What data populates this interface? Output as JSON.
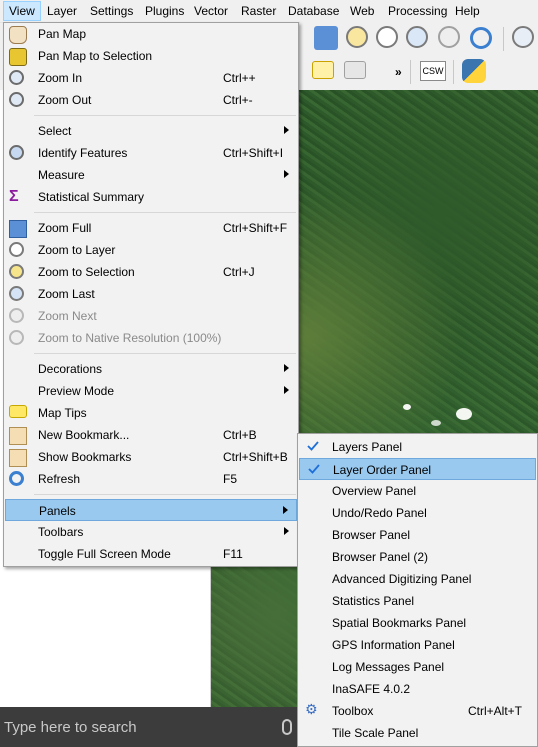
{
  "menubar": {
    "items": [
      "View",
      "Layer",
      "Settings",
      "Plugins",
      "Vector",
      "Raster",
      "Database",
      "Web",
      "Processing",
      "Help"
    ]
  },
  "view_menu": {
    "items": [
      {
        "label": "Pan Map",
        "shortcut": "",
        "icon": "pan-hand-icon"
      },
      {
        "label": "Pan Map to Selection",
        "shortcut": "",
        "icon": "pan-selection-icon"
      },
      {
        "label": "Zoom In",
        "shortcut": "Ctrl++",
        "icon": "zoom-in-icon"
      },
      {
        "label": "Zoom Out",
        "shortcut": "Ctrl+-",
        "icon": "zoom-out-icon"
      },
      {
        "label": "Select",
        "shortcut": "",
        "icon": "",
        "submenu": true
      },
      {
        "label": "Identify Features",
        "shortcut": "Ctrl+Shift+I",
        "icon": "identify-icon"
      },
      {
        "label": "Measure",
        "shortcut": "",
        "icon": "",
        "submenu": true
      },
      {
        "label": "Statistical Summary",
        "shortcut": "",
        "icon": "sigma-icon"
      },
      {
        "label": "Zoom Full",
        "shortcut": "Ctrl+Shift+F",
        "icon": "zoom-full-icon"
      },
      {
        "label": "Zoom to Layer",
        "shortcut": "",
        "icon": "zoom-layer-icon"
      },
      {
        "label": "Zoom to Selection",
        "shortcut": "Ctrl+J",
        "icon": "zoom-selection-icon"
      },
      {
        "label": "Zoom Last",
        "shortcut": "",
        "icon": "zoom-last-icon"
      },
      {
        "label": "Zoom Next",
        "shortcut": "",
        "icon": "zoom-next-icon",
        "disabled": true
      },
      {
        "label": "Zoom to Native Resolution (100%)",
        "shortcut": "",
        "icon": "zoom-native-icon",
        "disabled": true
      },
      {
        "label": "Decorations",
        "shortcut": "",
        "icon": "",
        "submenu": true
      },
      {
        "label": "Preview Mode",
        "shortcut": "",
        "icon": "",
        "submenu": true
      },
      {
        "label": "Map Tips",
        "shortcut": "",
        "icon": "map-tips-icon"
      },
      {
        "label": "New Bookmark...",
        "shortcut": "Ctrl+B",
        "icon": "new-bookmark-icon"
      },
      {
        "label": "Show Bookmarks",
        "shortcut": "Ctrl+Shift+B",
        "icon": "show-bookmarks-icon"
      },
      {
        "label": "Refresh",
        "shortcut": "F5",
        "icon": "refresh-icon"
      },
      {
        "label": "Panels",
        "shortcut": "",
        "icon": "",
        "submenu": true,
        "highlighted": true
      },
      {
        "label": "Toolbars",
        "shortcut": "",
        "icon": "",
        "submenu": true
      },
      {
        "label": "Toggle Full Screen Mode",
        "shortcut": "F11",
        "icon": ""
      }
    ]
  },
  "panels_menu": {
    "items": [
      {
        "label": "Layers Panel",
        "checked": true
      },
      {
        "label": "Layer Order Panel",
        "checked": true,
        "highlighted": true
      },
      {
        "label": "Overview Panel"
      },
      {
        "label": "Undo/Redo Panel"
      },
      {
        "label": "Browser Panel"
      },
      {
        "label": "Browser Panel (2)"
      },
      {
        "label": "Advanced Digitizing Panel"
      },
      {
        "label": "Statistics Panel"
      },
      {
        "label": "Spatial Bookmarks Panel"
      },
      {
        "label": "GPS Information Panel"
      },
      {
        "label": "Log Messages Panel"
      },
      {
        "label": "InaSAFE 4.0.2"
      },
      {
        "label": "Toolbox",
        "shortcut": "Ctrl+Alt+T",
        "icon": "toolbox-gear-icon"
      },
      {
        "label": "Tile Scale Panel"
      }
    ]
  },
  "toolbar": {
    "csw_label": "CSW",
    "more_label": "»"
  },
  "taskbar": {
    "search_placeholder": "Type here to search"
  },
  "colors": {
    "highlight": "#99c9ef",
    "check": "#1e6fd9"
  }
}
